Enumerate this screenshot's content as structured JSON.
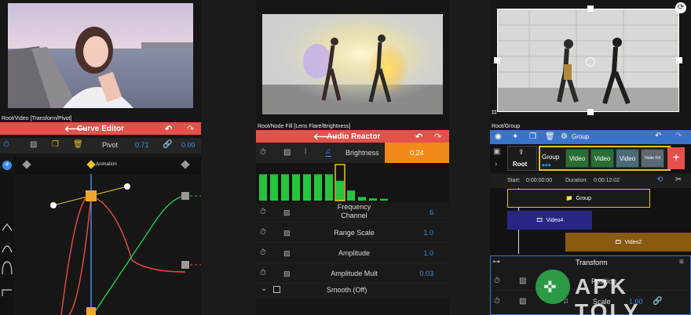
{
  "panel1": {
    "path": "Root/Video [Transform/Pivot]",
    "title": "Curve Editor",
    "prop_label": "Pivot",
    "val1": "0.71",
    "val2": "0.00",
    "keyframe_label": "Animation"
  },
  "panel2": {
    "path": "Root/Node Fill [Lens Flare/Brightness]",
    "title": "Audio Reactor",
    "brightness_label": "Brightness",
    "brightness_value": "0.24",
    "bars": [
      0.73,
      0.73,
      0.73,
      0.73,
      0.73,
      0.73,
      0.73,
      0.55,
      0.28,
      0.1,
      0.06,
      0.05
    ],
    "highlight_bar_index": 7,
    "params": [
      {
        "label": "Frequency\nChannel",
        "value": "6"
      },
      {
        "label": "Range Scale",
        "value": "1.0"
      },
      {
        "label": "Amplitude",
        "value": "1.0"
      },
      {
        "label": "Amplitude Mult",
        "value": "0.03"
      }
    ],
    "smooth_label": "Smooth (Off)"
  },
  "panel3": {
    "path": "Root/Group",
    "group_tab": "Group",
    "root_label": "Root",
    "group_label": "Group",
    "thumbs": [
      "Video",
      "Video",
      "Video",
      "Node Fill"
    ],
    "start_label": "Start:",
    "start_value": "0:00:00:00",
    "duration_label": "Duration:",
    "duration_value": "0:00:12:02",
    "tracks": [
      "Group",
      "Video4",
      "Video2"
    ],
    "transform_title": "Transform",
    "rows": [
      "Position",
      "Scale"
    ],
    "scale_value": "1.00"
  },
  "watermark": "APK TOLY",
  "colors": {
    "accent_red": "#e4514b",
    "accent_blue": "#3b8ee8",
    "accent_yellow": "#e8c22c",
    "bar_green": "#27c43d"
  }
}
